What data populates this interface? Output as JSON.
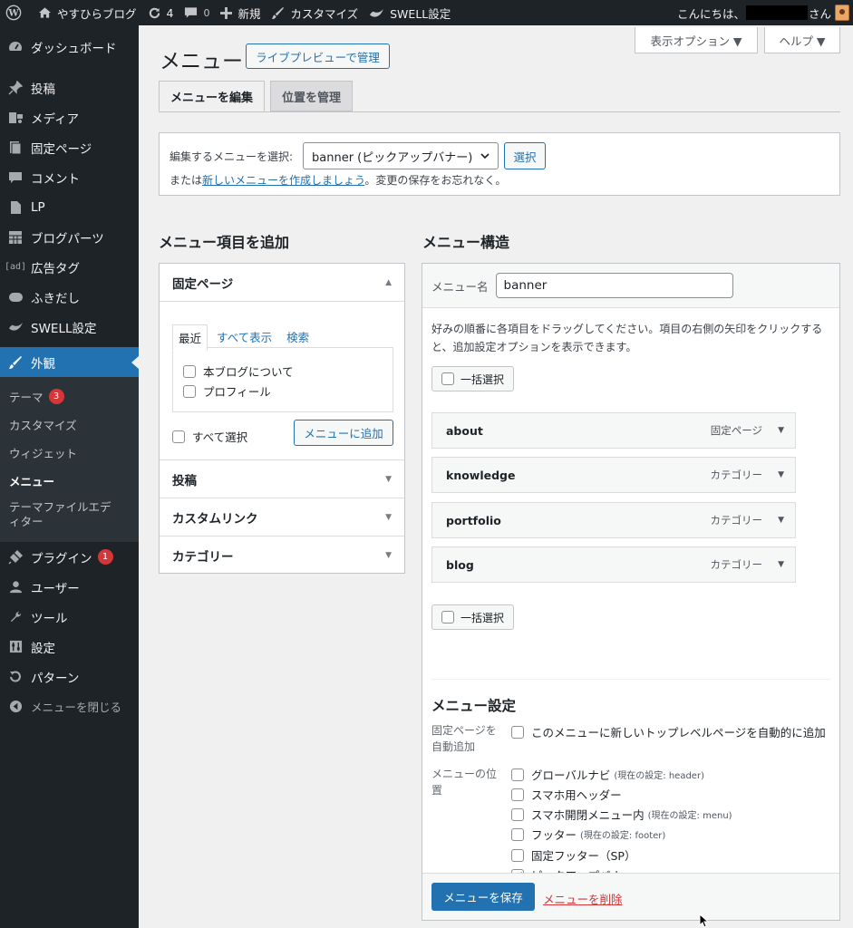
{
  "admin_bar": {
    "site_name": "やすひらブログ",
    "updates_count": "4",
    "comments_count": "0",
    "new_label": "新規",
    "customize_label": "カスタマイズ",
    "swell_label": "SWELL設定",
    "greeting_prefix": "こんにちは、",
    "greeting_suffix": "さん"
  },
  "sidebar": {
    "items": [
      {
        "label": "ダッシュボード",
        "icon": "dashboard-icon"
      },
      {
        "label": "投稿",
        "icon": "pin-icon"
      },
      {
        "label": "メディア",
        "icon": "media-icon"
      },
      {
        "label": "固定ページ",
        "icon": "page-icon"
      },
      {
        "label": "コメント",
        "icon": "comment-icon"
      },
      {
        "label": "LP",
        "icon": "file-icon"
      },
      {
        "label": "ブログパーツ",
        "icon": "grid-icon"
      },
      {
        "label": "広告タグ",
        "icon": "ad-icon"
      },
      {
        "label": "ふきだし",
        "icon": "bubble-icon"
      },
      {
        "label": "SWELL設定",
        "icon": "swell-icon"
      }
    ],
    "active": {
      "label": "外観",
      "icon": "brush-icon"
    },
    "submenu": [
      {
        "label": "テーマ",
        "badge": "3"
      },
      {
        "label": "カスタマイズ"
      },
      {
        "label": "ウィジェット"
      },
      {
        "label": "メニュー"
      },
      {
        "label": "テーマファイルエディター"
      }
    ],
    "items2": [
      {
        "label": "プラグイン",
        "icon": "plugin-icon",
        "badge": "1"
      },
      {
        "label": "ユーザー",
        "icon": "user-icon"
      },
      {
        "label": "ツール",
        "icon": "wrench-icon"
      },
      {
        "label": "設定",
        "icon": "settings-icon"
      },
      {
        "label": "パターン",
        "icon": "pattern-icon"
      }
    ],
    "collapse_label": "メニューを閉じる"
  },
  "header": {
    "screen_options": "表示オプション ▼",
    "help": "ヘルプ ▼",
    "title": "メニュー",
    "live_preview": "ライブプレビューで管理",
    "tab_edit": "メニューを編集",
    "tab_locations": "位置を管理"
  },
  "select_menu": {
    "label": "編集するメニューを選択:",
    "selected": "banner (ピックアップバナー)",
    "select_button": "選択",
    "line2_prefix": "または",
    "line2_link": "新しいメニューを作成しましょう",
    "line2_suffix": "。変更の保存をお忘れなく。"
  },
  "add_items": {
    "heading": "メニュー項目を追加",
    "pages_header": "固定ページ",
    "tabs": [
      "最近",
      "すべて表示",
      "検索"
    ],
    "pages": [
      "本ブログについて",
      "プロフィール"
    ],
    "select_all": "すべて選択",
    "add_button": "メニューに追加",
    "sections": [
      "投稿",
      "カスタムリンク",
      "カテゴリー"
    ]
  },
  "structure": {
    "heading": "メニュー構造",
    "name_label": "メニュー名",
    "name_value": "banner",
    "hint": "好みの順番に各項目をドラッグしてください。項目の右側の矢印をクリックすると、追加設定オプションを表示できます。",
    "bulk_select": "一括選択",
    "items": [
      {
        "title": "about",
        "type": "固定ページ"
      },
      {
        "title": "knowledge",
        "type": "カテゴリー"
      },
      {
        "title": "portfolio",
        "type": "カテゴリー"
      },
      {
        "title": "blog",
        "type": "カテゴリー"
      }
    ],
    "settings_heading": "メニュー設定",
    "auto_add_label": "固定ページを自動追加",
    "auto_add_option": "このメニューに新しいトップレベルページを自動的に追加",
    "location_label": "メニューの位置",
    "locations": [
      {
        "label": "グローバルナビ",
        "note": "(現在の設定: header)",
        "checked": false
      },
      {
        "label": "スマホ用ヘッダー",
        "note": "",
        "checked": false
      },
      {
        "label": "スマホ開閉メニュー内",
        "note": "(現在の設定: menu)",
        "checked": false
      },
      {
        "label": "フッター",
        "note": "(現在の設定: footer)",
        "checked": false
      },
      {
        "label": "固定フッター（SP）",
        "note": "",
        "checked": false
      },
      {
        "label": "ピックアップバナー",
        "note": "",
        "checked": true
      }
    ],
    "save_button": "メニューを保存",
    "delete_link": "メニューを削除"
  }
}
